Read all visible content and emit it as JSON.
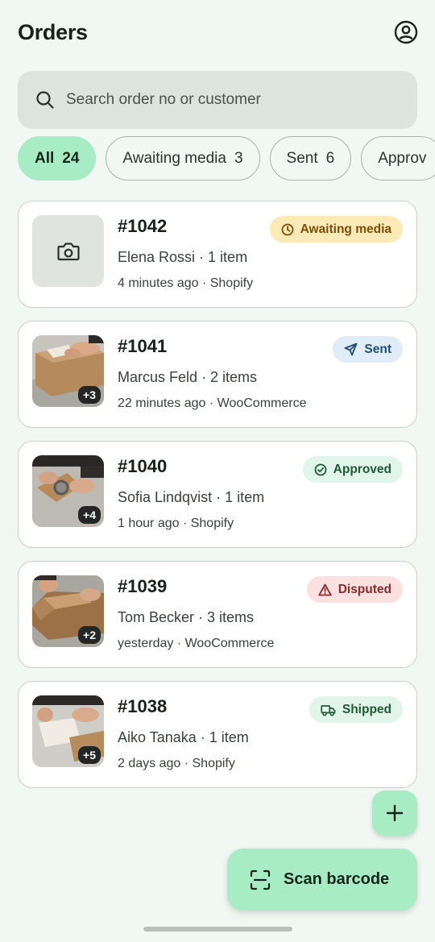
{
  "header": {
    "title": "Orders",
    "account_icon": "account-circle-icon"
  },
  "search": {
    "placeholder": "Search order no or customer",
    "value": ""
  },
  "filters": [
    {
      "label": "All",
      "count": "24",
      "active": true
    },
    {
      "label": "Awaiting media",
      "count": "3",
      "active": false
    },
    {
      "label": "Sent",
      "count": "6",
      "active": false
    },
    {
      "label": "Approv",
      "count": "",
      "active": false
    }
  ],
  "orders": [
    {
      "number": "#1042",
      "customer": "Elena Rossi · 1 item",
      "meta": "4 minutes ago · Shopify",
      "status": "Awaiting media",
      "status_icon": "clock-icon",
      "extra_photos": ""
    },
    {
      "number": "#1041",
      "customer": "Marcus Feld · 2 items",
      "meta": "22 minutes ago · WooCommerce",
      "status": "Sent",
      "status_icon": "send-icon",
      "extra_photos": "+3"
    },
    {
      "number": "#1040",
      "customer": "Sofia Lindqvist · 1 item",
      "meta": "1 hour ago · Shopify",
      "status": "Approved",
      "status_icon": "check-circle-icon",
      "extra_photos": "+4"
    },
    {
      "number": "#1039",
      "customer": "Tom Becker · 3 items",
      "meta": "yesterday · WooCommerce",
      "status": "Disputed",
      "status_icon": "warning-icon",
      "extra_photos": "+2"
    },
    {
      "number": "#1038",
      "customer": "Aiko Tanaka · 1 item",
      "meta": "2 days ago · Shopify",
      "status": "Shipped",
      "status_icon": "truck-icon",
      "extra_photos": "+5"
    }
  ],
  "actions": {
    "add_label": "+",
    "scan_label": "Scan barcode"
  },
  "colors": {
    "background": "#f1f8f3",
    "accent": "#a8ecc6",
    "awaiting": "#fbe9b8",
    "sent": "#e0ecf7",
    "approved": "#e2f5ea",
    "disputed": "#fbe0e0",
    "shipped": "#e3f4ea"
  }
}
